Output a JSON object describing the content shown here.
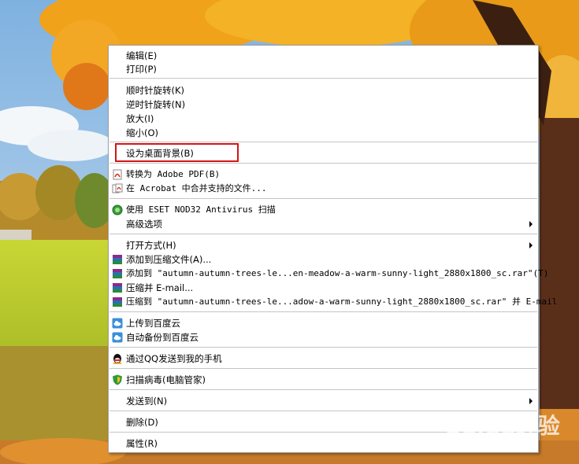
{
  "menu": {
    "items": [
      {
        "label": "编辑(E)"
      },
      {
        "label": "打印(P)"
      },
      {
        "label": "顺时针旋转(K)"
      },
      {
        "label": "逆时针旋转(N)"
      },
      {
        "label": "放大(I)"
      },
      {
        "label": "缩小(O)"
      },
      {
        "label": "设为桌面背景(B)"
      },
      {
        "label": "转换为 Adobe PDF(B)",
        "icon": "adobe-pdf-icon"
      },
      {
        "label": "在 Acrobat 中合并支持的文件...",
        "icon": "acrobat-icon"
      },
      {
        "label": "使用 ESET NOD32 Antivirus 扫描",
        "icon": "eset-icon"
      },
      {
        "label": "高级选项",
        "submenu": true
      },
      {
        "label": "打开方式(H)",
        "submenu": true
      },
      {
        "label": "添加到压缩文件(A)...",
        "icon": "winrar-icon"
      },
      {
        "label": "添加到 \"autumn-autumn-trees-le...en-meadow-a-warm-sunny-light_2880x1800_sc.rar\"(T)",
        "icon": "winrar-icon"
      },
      {
        "label": "压缩并 E-mail...",
        "icon": "winrar-icon"
      },
      {
        "label": "压缩到 \"autumn-autumn-trees-le...adow-a-warm-sunny-light_2880x1800_sc.rar\" 并 E-mail",
        "icon": "winrar-icon"
      },
      {
        "label": "上传到百度云",
        "icon": "baidu-cloud-icon"
      },
      {
        "label": "自动备份到百度云",
        "icon": "baidu-cloud-icon"
      },
      {
        "label": "通过QQ发送到我的手机",
        "icon": "qq-icon"
      },
      {
        "label": "扫描病毒(电脑管家)",
        "icon": "tencent-shield-icon"
      },
      {
        "label": "发送到(N)",
        "submenu": true
      },
      {
        "label": "删除(D)"
      },
      {
        "label": "属性(R)"
      }
    ]
  },
  "watermark": {
    "brand": "Baidu经验",
    "url": "jingyan.baidu.com"
  },
  "colors": {
    "highlight_box": "#d41515",
    "menu_bg": "#ffffff"
  }
}
